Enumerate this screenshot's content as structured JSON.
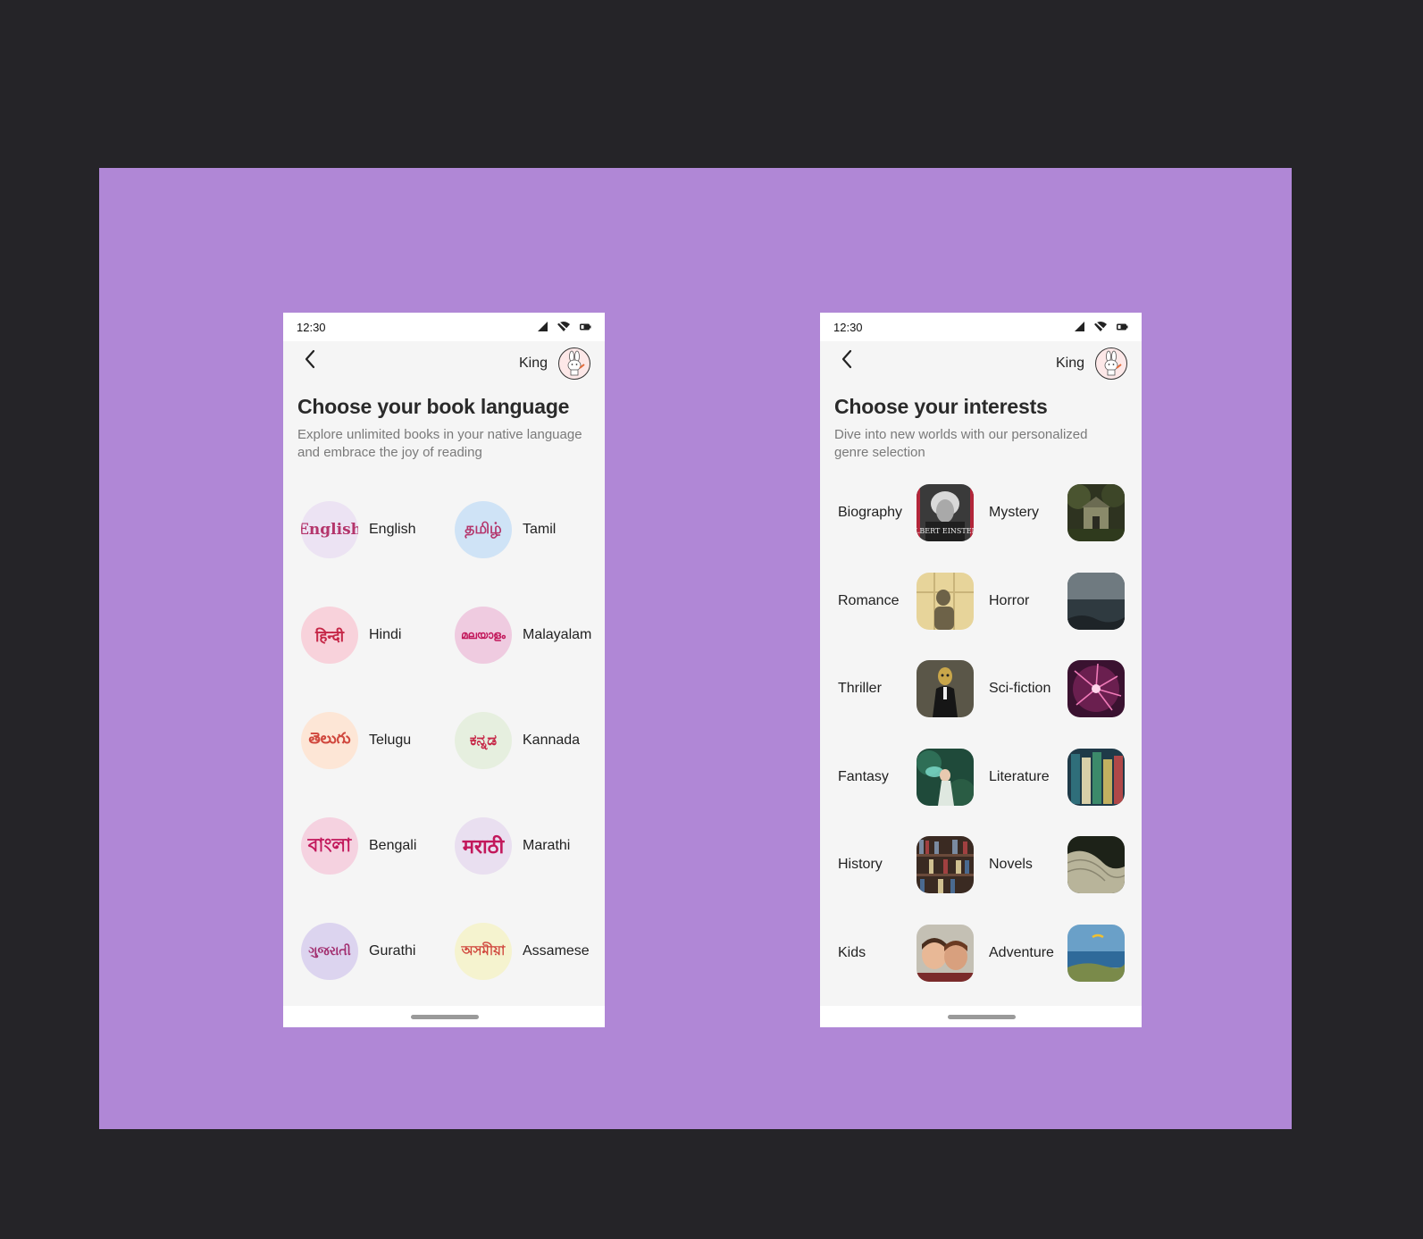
{
  "colors": {
    "outer_background": "#252428",
    "canvas_background": "#b087d6",
    "phone_background": "#f5f5f5",
    "script_accent": "#c2185b"
  },
  "status_bar": {
    "time": "12:30"
  },
  "header": {
    "user_name": "King"
  },
  "language_screen": {
    "title": "Choose your book language",
    "subtitle": "Explore unlimited books in your native language and embrace the joy of reading",
    "languages": [
      {
        "script": "English",
        "label": "English",
        "circle_color": "#ece3f3",
        "script_color": "#b4356b"
      },
      {
        "script": "தமிழ்",
        "label": "Tamil",
        "circle_color": "#cfe3f6",
        "script_color": "#b4356b"
      },
      {
        "script": "हिन्दी",
        "label": "Hindi",
        "circle_color": "#f8d2db",
        "script_color": "#c62848"
      },
      {
        "script": "മലയാളം",
        "label": "Malayalam",
        "circle_color": "#efcbe0",
        "script_color": "#c2185b"
      },
      {
        "script": "తెలుగు",
        "label": "Telugu",
        "circle_color": "#fde6d6",
        "script_color": "#d0473d"
      },
      {
        "script": "ಕನ್ನಡ",
        "label": "Kannada",
        "circle_color": "#e6efdf",
        "script_color": "#c62848"
      },
      {
        "script": "বাংলা",
        "label": "Bengali",
        "circle_color": "#f5d2e0",
        "script_color": "#c2185b"
      },
      {
        "script": "मराठी",
        "label": "Marathi",
        "circle_color": "#e9dff0",
        "script_color": "#c2185b"
      },
      {
        "script": "ગુજરાતી",
        "label": "Gurathi",
        "circle_color": "#dcd4ef",
        "script_color": "#a22e6f"
      },
      {
        "script": "অসমীয়া",
        "label": "Assamese",
        "circle_color": "#f5f3cf",
        "script_color": "#d0473d"
      }
    ]
  },
  "interests_screen": {
    "title": "Choose your interests",
    "subtitle": "Dive into new worlds with our personalized genre selection",
    "genres": [
      {
        "label": "Biography",
        "thumb": "portrait-photo"
      },
      {
        "label": "Mystery",
        "thumb": "old-house-photo"
      },
      {
        "label": "Romance",
        "thumb": "couple-shadow-photo"
      },
      {
        "label": "Horror",
        "thumb": "stormy-sea-photo"
      },
      {
        "label": "Thriller",
        "thumb": "masked-figure-photo"
      },
      {
        "label": "Sci-fiction",
        "thumb": "plasma-ball-photo"
      },
      {
        "label": "Fantasy",
        "thumb": "fairy-forest-photo"
      },
      {
        "label": "Literature",
        "thumb": "book-spines-photo"
      },
      {
        "label": "History",
        "thumb": "bookshelf-photo"
      },
      {
        "label": "Novels",
        "thumb": "open-book-photo"
      },
      {
        "label": "Kids",
        "thumb": "children-photo"
      },
      {
        "label": "Adventure",
        "thumb": "paraglider-coast-photo"
      }
    ],
    "biography_thumb_text": "ALBERT EINSTEIN"
  }
}
